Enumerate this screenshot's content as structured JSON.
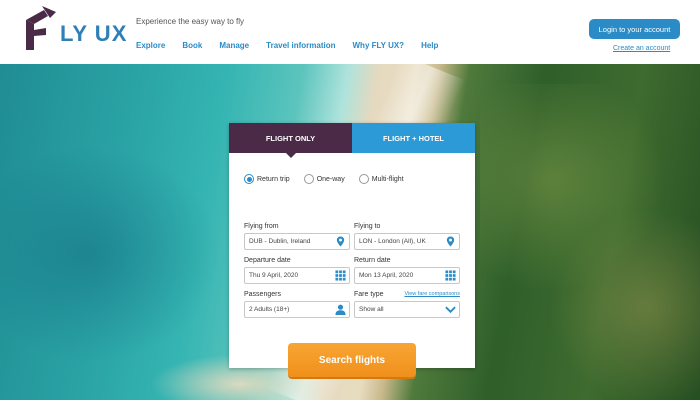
{
  "header": {
    "logo_text": "LY UX",
    "tagline": "Experience the easy way to fly",
    "nav": [
      "Explore",
      "Book",
      "Manage",
      "Travel information",
      "Why FLY UX?",
      "Help"
    ],
    "login_label": "Login to your account",
    "create_account_label": "Create an account"
  },
  "booking": {
    "tabs": [
      "FLIGHT ONLY",
      "FLIGHT + HOTEL"
    ],
    "active_tab": "FLIGHT ONLY",
    "trip_types": [
      "Return trip",
      "One-way",
      "Multi-flight"
    ],
    "selected_trip_type": "Return trip",
    "from": {
      "label": "Flying from",
      "value": "DUB - Dublin, Ireland"
    },
    "to": {
      "label": "Flying to",
      "value": "LON - London (All), UK"
    },
    "departure": {
      "label": "Departure date",
      "value": "Thu 9 April, 2020"
    },
    "return": {
      "label": "Return date",
      "value": "Mon 13 April, 2020"
    },
    "passengers": {
      "label": "Passengers",
      "value": "2 Adults (18+)"
    },
    "fare": {
      "label": "Fare type",
      "value": "Show all",
      "compare_link": "View fare comparisons"
    },
    "search_label": "Search flights"
  },
  "colors": {
    "brand_purple": "#4b2a47",
    "brand_blue": "#2b8bc6",
    "search_orange": "#f39a2a"
  }
}
